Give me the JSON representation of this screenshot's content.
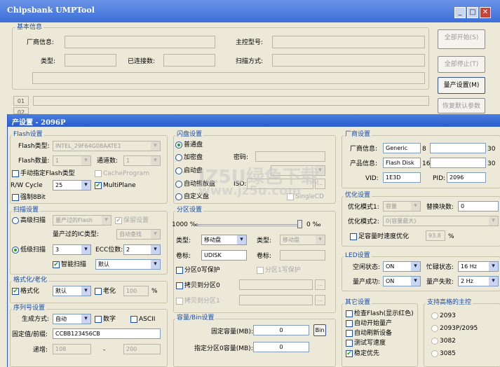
{
  "main": {
    "title": "Chipsbank UMPTool",
    "basic": {
      "legend": "基本信息",
      "vendor": "厂商信息:",
      "controller": "主控型号:",
      "type": "类型:",
      "connected": "已连接数:",
      "scan": "扫描方式:"
    },
    "buttons": {
      "start_all": "全部开始(S)",
      "stop_all": "全部停止(T)",
      "settings": "量产设置(M)",
      "restore": "恢复默认参数"
    },
    "ports": [
      "01",
      "02"
    ]
  },
  "dlg": {
    "title": "产设置 - 2096P",
    "flash": {
      "legend": "Flash设置",
      "type_label": "Flash类型:",
      "type_value": "INTEL_29F64G08AATE1",
      "count_label": "Flash数量:",
      "count_value": "1",
      "channel_label": "通道数:",
      "channel_value": "1",
      "manual": "手动指定Flash类型",
      "cache": "CacheProgram",
      "rw_label": "R/W Cycle",
      "rw_value": "25",
      "multiplane": "MultiPlane",
      "force": "强制8Bit"
    },
    "scan": {
      "legend": "扫描设置",
      "advanced": "高级扫描",
      "adv_value": "量产过的Flash",
      "keep": "保留设置",
      "ic_label": "量产过的IC类型:",
      "ic_value": "自动查找",
      "low": "低级扫描",
      "low_value": "3",
      "ecc_label": "ECC位数:",
      "ecc_value": "2",
      "smart": "智能扫描",
      "smart_value": "默认"
    },
    "format": {
      "legend": "格式化/老化",
      "format": "格式化",
      "format_value": "默认",
      "aging": "老化",
      "aging_value": "100",
      "percent": "%"
    },
    "serial": {
      "legend": "序列号设置",
      "gen_label": "生成方式:",
      "gen_value": "自动",
      "digit": "数字",
      "ascii": "ASCII",
      "prefix_label": "固定值/前缀:",
      "prefix_value": "CCBB123456CB",
      "inc_label": "递增:",
      "inc_from": "108",
      "inc_to": "200",
      "dash": "-"
    },
    "disk": {
      "legend": "闪盘设置",
      "normal": "普通盘",
      "encrypt": "加密盘",
      "password": "密码:",
      "boot": "启动盘",
      "auto": "自动播放盘",
      "iso": "ISO:",
      "custom": "自定义盘",
      "single": "SingleCD"
    },
    "part": {
      "legend": "分区设置",
      "left_pct": "1000 ‰",
      "right_pct": "0 ‰",
      "type_label": "类型:",
      "type_value": "移动盘",
      "type2_value": "移动盘",
      "vol_label": "卷标:",
      "vol_value": "UDISK",
      "vol2_label": "卷标:",
      "wp0": "分区0写保护",
      "wp1": "分区1写保护",
      "copy0": "拷贝到分区0",
      "copy1": "拷贝到分区1",
      "browse": "..."
    },
    "cap": {
      "legend": "容量/Bin设置",
      "fixed_label": "固定容量(MB):",
      "fixed_value": "0",
      "bin": "Bin",
      "part0_label": "指定分区0容量(MB):",
      "part0_value": "0"
    },
    "vendor": {
      "legend": "厂商设置",
      "vendor_label": "厂商信息:",
      "vendor_value": "Generic",
      "vendor_len": "8",
      "vendor_max": "30",
      "product_label": "产品信息:",
      "product_value": "Flash Disk",
      "product_len": "16",
      "product_max": "30",
      "vid_label": "VID:",
      "vid_value": "1E3D",
      "pid_label": "PID:",
      "pid_value": "2096"
    },
    "opt": {
      "legend": "优化设置",
      "mode1_label": "优化模式1:",
      "mode1_value": "容量",
      "replace_label": "替换块数:",
      "replace_value": "0",
      "mode2_label": "优化模式2:",
      "mode2_value": "0(容量最大)",
      "speed": "足容量时速度优化",
      "speed_value": "93.8",
      "percent": "%"
    },
    "led": {
      "legend": "LED设置",
      "idle_label": "空闲状态:",
      "idle_value": "ON",
      "busy_label": "忙碌状态:",
      "busy_value": "16 Hz",
      "ok_label": "量产成功:",
      "ok_value": "ON",
      "fail_label": "量产失败:",
      "fail_value": "2 Hz"
    },
    "other": {
      "legend": "其它设置",
      "items": [
        "检查Flash(显示红色)",
        "自动开始量产",
        "自动刷新设备",
        "测试写速度",
        "稳定优先"
      ]
    },
    "ctrl": {
      "legend": "支持高格的主控",
      "items": [
        "2093",
        "2093P/2095",
        "3082",
        "3085"
      ]
    }
  },
  "watermark": {
    "text1": "JZ5U绿色下载",
    "text2": "www.jz5u.com"
  },
  "colors": {
    "title_bar": "#3c6fd8",
    "label_blue": "#1a4ca8",
    "check_green": "#21a121"
  }
}
